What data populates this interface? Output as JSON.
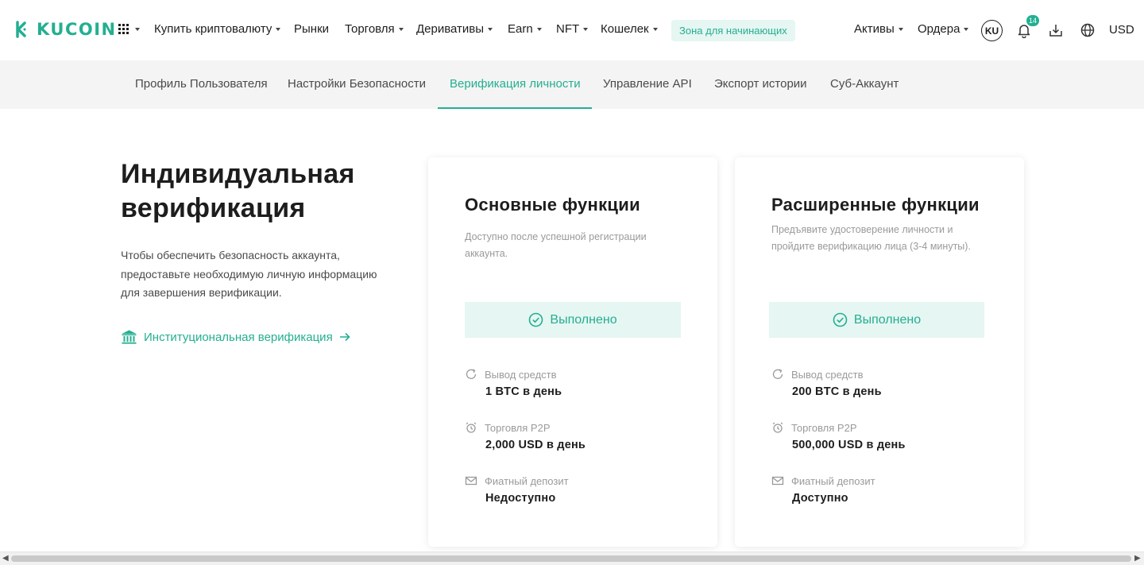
{
  "brand": {
    "name": "KUCOIN",
    "accent": "#23af91"
  },
  "topnav": {
    "items": [
      {
        "label": "Купить криптовалюту",
        "dropdown": true
      },
      {
        "label": "Рынки",
        "dropdown": false
      },
      {
        "label": "Торговля",
        "dropdown": true
      },
      {
        "label": "Деривативы",
        "dropdown": true
      },
      {
        "label": "Earn",
        "dropdown": true
      },
      {
        "label": "NFT",
        "dropdown": true
      },
      {
        "label": "Кошелек",
        "dropdown": true
      }
    ],
    "beginner_zone": "Зона для начинающих",
    "assets": "Активы",
    "orders": "Ордера",
    "avatar": "KU",
    "notifications_count": "14",
    "currency": "USD"
  },
  "subnav": {
    "tabs": [
      "Профиль Пользователя",
      "Настройки Безопасности",
      "Верификация личности",
      "Управление API",
      "Экспорт истории",
      "Суб-Аккаунт"
    ],
    "active_index": 2
  },
  "intro": {
    "title": "Индивидуальная верификация",
    "description": "Чтобы обеспечить безопасность аккаунта, предоставьте необходимую личную информацию для завершения верификации.",
    "institutional_link": "Институциональная верификация"
  },
  "cards": [
    {
      "title": "Основные функции",
      "description": "Доступно после успешной регистрации аккаунта.",
      "status": "Выполнено",
      "features": [
        {
          "icon": "withdraw-icon",
          "label": "Вывод средств",
          "value": "1 BTC в день"
        },
        {
          "icon": "p2p-icon",
          "label": "Торговля P2P",
          "value": "2,000 USD в день"
        },
        {
          "icon": "fiat-deposit-icon",
          "label": "Фиатный депозит",
          "value": "Недоступно"
        }
      ]
    },
    {
      "title": "Расширенные функции",
      "description": "Предъявите удостоверение личности и пройдите верификацию лица (3-4 минуты).",
      "status": "Выполнено",
      "features": [
        {
          "icon": "withdraw-icon",
          "label": "Вывод средств",
          "value": "200 BTC в день"
        },
        {
          "icon": "p2p-icon",
          "label": "Торговля P2P",
          "value": "500,000 USD в день"
        },
        {
          "icon": "fiat-deposit-icon",
          "label": "Фиатный депозит",
          "value": "Доступно"
        }
      ]
    }
  ]
}
